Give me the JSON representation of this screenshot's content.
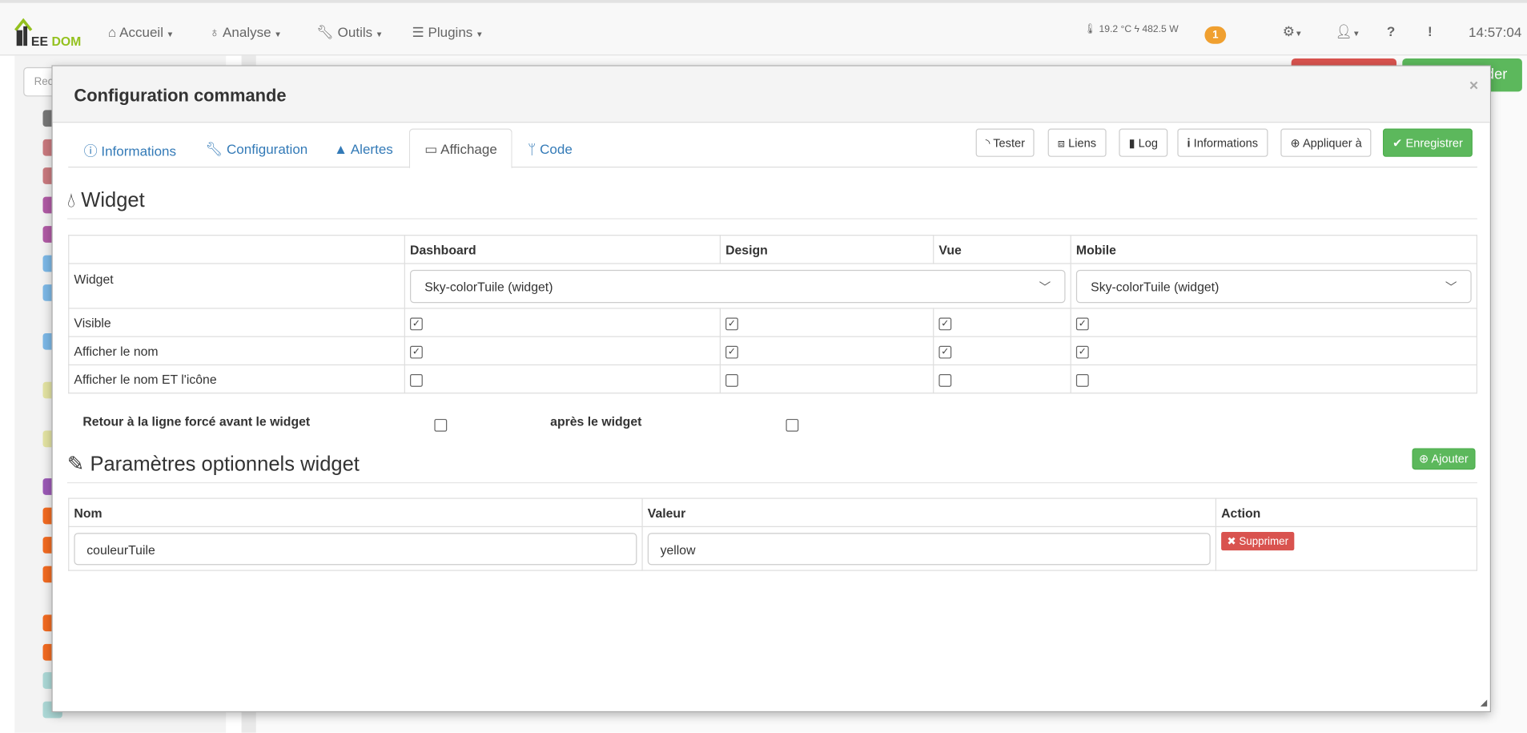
{
  "header": {
    "logo_text": "JEEDOM",
    "nav": [
      {
        "label": "Accueil",
        "icon": "home-icon"
      },
      {
        "label": "Analyse",
        "icon": "stethoscope-icon"
      },
      {
        "label": "Outils",
        "icon": "wrench-icon"
      },
      {
        "label": "Plugins",
        "icon": "tasks-icon"
      }
    ],
    "temperature": "19.2 °C",
    "power": "482.5 W",
    "notification_count": "1",
    "time": "14:57:04"
  },
  "background": {
    "search_placeholder": "Rec",
    "right_green_button": "der"
  },
  "modal": {
    "title": "Configuration commande",
    "close": "×",
    "tabs": [
      {
        "label": "Informations",
        "icon": "info-circle-icon"
      },
      {
        "label": "Configuration",
        "icon": "wrench-icon"
      },
      {
        "label": "Alertes",
        "icon": "warning-icon"
      },
      {
        "label": "Affichage",
        "icon": "desktop-icon",
        "active": true
      },
      {
        "label": "Code",
        "icon": "code-branch-icon"
      }
    ],
    "actions": [
      {
        "label": "Tester",
        "icon": "rss-icon"
      },
      {
        "label": "Liens",
        "icon": "object-group-icon"
      },
      {
        "label": "Log",
        "icon": "file-icon"
      },
      {
        "label": "Informations",
        "icon": "info-icon"
      },
      {
        "label": "Appliquer à",
        "icon": "plus-circle-icon"
      },
      {
        "label": "Enregistrer",
        "icon": "check-circle-icon"
      }
    ],
    "widget_section": {
      "title": "Widget",
      "columns": [
        "",
        "Dashboard",
        "Design",
        "Vue",
        "Mobile"
      ],
      "widget_row_label": "Widget",
      "dashboard_widget": "Sky-colorTuile (widget)",
      "mobile_widget": "Sky-colorTuile (widget)",
      "rows": [
        {
          "label": "Visible",
          "checked": [
            true,
            true,
            true,
            true
          ]
        },
        {
          "label": "Afficher le nom",
          "checked": [
            true,
            true,
            true,
            true
          ]
        },
        {
          "label": "Afficher le nom ET l'icône",
          "checked": [
            false,
            false,
            false,
            false
          ]
        }
      ],
      "line_break_before": "Retour à la ligne forcé avant le widget",
      "line_break_after": "après le widget",
      "line_break_before_checked": false,
      "line_break_after_checked": false
    },
    "params_section": {
      "title": "Paramètres optionnels widget",
      "add_label": "Ajouter",
      "columns": [
        "Nom",
        "Valeur",
        "Action"
      ],
      "rows": [
        {
          "name": "couleurTuile",
          "value": "yellow",
          "delete_label": "Supprimer"
        }
      ]
    }
  },
  "colors": {
    "primary_link": "#337ab7",
    "success": "#5cb85c",
    "danger": "#d9534f",
    "warning_badge": "#f0a030"
  }
}
